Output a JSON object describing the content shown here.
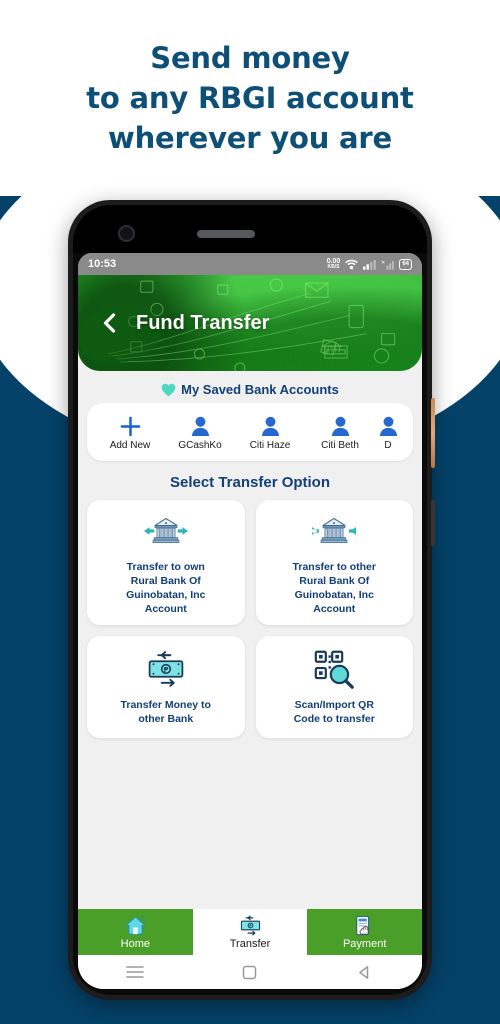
{
  "promo": {
    "headline_line1": "Send money",
    "headline_line2": "to any RBGI account",
    "headline_line3": "wherever you are",
    "background_color": "#044269",
    "headline_color": "#0e4f78"
  },
  "phone": {
    "statusbar": {
      "time": "10:53",
      "net_speed_value": "0.00",
      "net_speed_unit": "KB/S",
      "battery_level": "64"
    },
    "android_nav": {
      "recents_label": "recents",
      "home_label": "home",
      "back_label": "back"
    }
  },
  "app": {
    "header": {
      "title": "Fund Transfer",
      "back_label": "Back",
      "accent_color": "#23ab22"
    },
    "saved_accounts": {
      "section_title": "My Saved Bank Accounts",
      "heart_color": "#4ed8c0",
      "items": [
        {
          "label": "Add New",
          "icon": "plus-icon"
        },
        {
          "label": "GCashKo",
          "icon": "person-icon"
        },
        {
          "label": "Citi Haze",
          "icon": "person-icon"
        },
        {
          "label": "Citi Beth",
          "icon": "person-icon"
        },
        {
          "label": "D",
          "icon": "person-icon"
        }
      ]
    },
    "transfer_options": {
      "section_title": "Select Transfer Option",
      "items": [
        {
          "label": "Transfer to own\nRural Bank Of\nGuinobatan, Inc\nAccount",
          "icon": "bank-transfer-in-icon"
        },
        {
          "label": "Transfer to other\nRural Bank Of\nGuinobatan, Inc\nAccount",
          "icon": "bank-transfer-out-icon"
        },
        {
          "label": "Transfer Money to\nother Bank",
          "icon": "money-exchange-icon"
        },
        {
          "label": "Scan/Import QR\nCode to transfer",
          "icon": "qr-scan-icon"
        }
      ]
    },
    "bottom_nav": {
      "active_index": 1,
      "items": [
        {
          "label": "Home",
          "icon": "home-icon"
        },
        {
          "label": "Transfer",
          "icon": "money-exchange-icon"
        },
        {
          "label": "Payment",
          "icon": "mobile-payment-icon"
        }
      ]
    }
  }
}
